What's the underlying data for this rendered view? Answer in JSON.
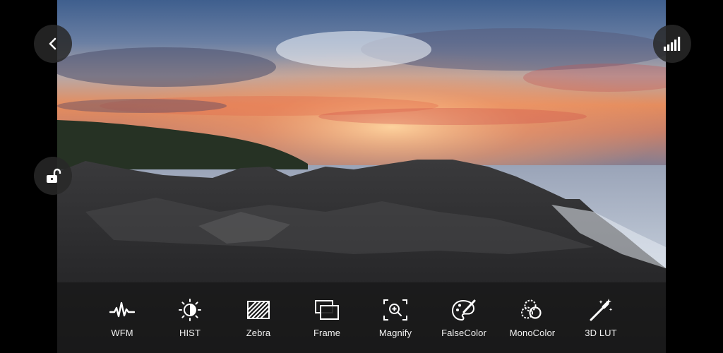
{
  "colors": {
    "toolbar_bg": "#181818",
    "icon_color": "#ffffff",
    "label_color": "#f2f2f2",
    "side_button_bg": "#282828"
  },
  "top_controls": {
    "back_icon": "chevron-left-icon",
    "lock_icon": "unlocked-padlock-icon",
    "signal_icon": "signal-bars-icon"
  },
  "toolbar": {
    "tools": [
      {
        "label": "WFM",
        "icon": "waveform-icon"
      },
      {
        "label": "HIST",
        "icon": "histogram-contrast-icon"
      },
      {
        "label": "Zebra",
        "icon": "zebra-stripes-icon"
      },
      {
        "label": "Frame",
        "icon": "frame-icon"
      },
      {
        "label": "Magnify",
        "icon": "magnify-icon"
      },
      {
        "label": "FalseColor",
        "icon": "palette-brush-icon"
      },
      {
        "label": "MonoColor",
        "icon": "monocolor-icon"
      },
      {
        "label": "3D LUT",
        "icon": "magic-wand-icon"
      }
    ]
  }
}
